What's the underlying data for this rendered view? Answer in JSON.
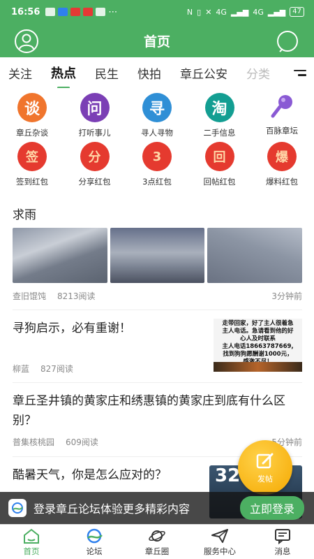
{
  "status_bar": {
    "time": "16:56",
    "dots": "⋯",
    "network1": "4G",
    "network2": "4G",
    "battery": "47"
  },
  "header": {
    "title": "首页"
  },
  "tabs": [
    "关注",
    "热点",
    "民生",
    "快拍",
    "章丘公安",
    "分类"
  ],
  "grid": {
    "row1": [
      {
        "label": "章丘杂谈",
        "glyph": "谈",
        "color": "#f0752d"
      },
      {
        "label": "打听事儿",
        "glyph": "问",
        "color": "#7b3fb5"
      },
      {
        "label": "寻人寻物",
        "glyph": "寻",
        "color": "#2f8fd6"
      },
      {
        "label": "二手信息",
        "glyph": "淘",
        "color": "#139e92"
      },
      {
        "label": "百脉章坛",
        "glyph": "",
        "color": "#8a5ad4"
      }
    ],
    "row2": [
      {
        "label": "签到红包",
        "glyph": "签"
      },
      {
        "label": "分享红包",
        "glyph": "分"
      },
      {
        "label": "3点红包",
        "glyph": "3"
      },
      {
        "label": "回帖红包",
        "glyph": "回"
      },
      {
        "label": "爆料红包",
        "glyph": "爆"
      }
    ]
  },
  "section": {
    "title": "求雨"
  },
  "posts": [
    {
      "author": "查旧馄饨",
      "reads": "8213阅读",
      "time": "3分钟前"
    },
    {
      "title": "寻狗启示，必有重谢！",
      "author": "柳蓝",
      "reads": "827阅读",
      "thumb_lines": [
        "走带回家，好了主人很着急",
        "主人电话。急请看到他的好",
        "心人及时联系",
        "主人电话18663787669,",
        "找到狗狗愿酬谢1000元，",
        "感激不尽！"
      ]
    },
    {
      "title": "章丘圣井镇的黄家庄和绣惠镇的黄家庄到底有什么区别？",
      "author": "普集核桃园",
      "reads": "609阅读",
      "time": "5分钟前"
    },
    {
      "title": "酷暑天气，你是怎么应对的？",
      "thumb_temp": "32°"
    }
  ],
  "fab": {
    "label": "发帖"
  },
  "login_bar": {
    "message": "登录章丘论坛体验更多精彩内容",
    "button": "立即登录"
  },
  "bottom_nav": [
    {
      "label": "首页"
    },
    {
      "label": "论坛"
    },
    {
      "label": "章丘圈"
    },
    {
      "label": "服务中心"
    },
    {
      "label": "消息"
    }
  ],
  "colors": {
    "brand_green": "#4caf62",
    "red_packet": "#e53a2f",
    "fab_yellow": "#f5a800"
  }
}
